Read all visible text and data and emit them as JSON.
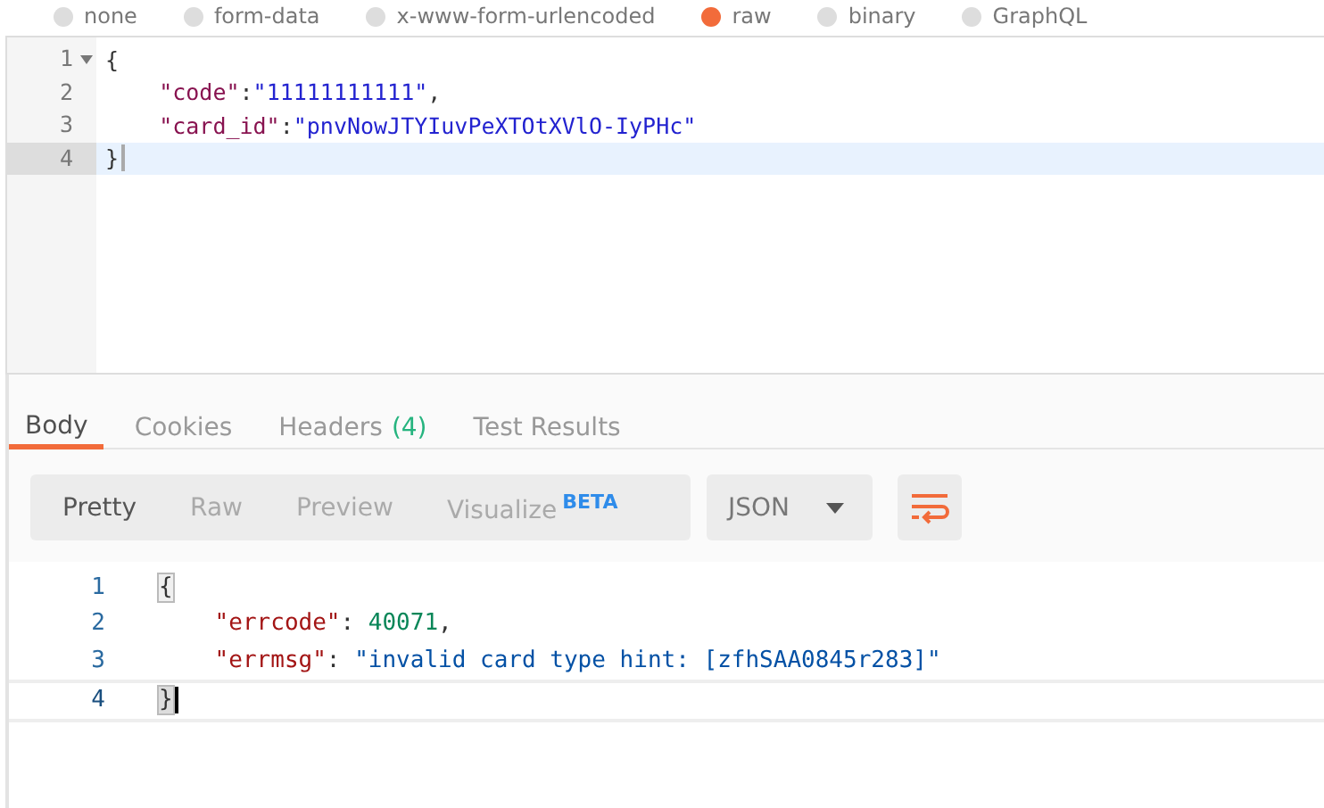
{
  "body_types": [
    {
      "label": "none",
      "selected": false
    },
    {
      "label": "form-data",
      "selected": false
    },
    {
      "label": "x-www-form-urlencoded",
      "selected": false
    },
    {
      "label": "raw",
      "selected": true
    },
    {
      "label": "binary",
      "selected": false
    },
    {
      "label": "GraphQL",
      "selected": false
    }
  ],
  "request_editor": {
    "lines": [
      {
        "number": "1",
        "foldable": true,
        "active": false,
        "tokens": [
          {
            "kind": "punct",
            "text": "{"
          }
        ]
      },
      {
        "number": "2",
        "foldable": false,
        "active": false,
        "tokens": [
          {
            "kind": "key",
            "text": "    \"code\""
          },
          {
            "kind": "punct",
            "text": ":"
          },
          {
            "kind": "string",
            "text": "\"11111111111\""
          },
          {
            "kind": "punct",
            "text": ","
          }
        ]
      },
      {
        "number": "3",
        "foldable": false,
        "active": false,
        "tokens": [
          {
            "kind": "key",
            "text": "    \"card_id\""
          },
          {
            "kind": "punct",
            "text": ":"
          },
          {
            "kind": "string",
            "text": "\"pnvNowJTYIuvPeXTOtXVlO-IyPHc\""
          }
        ]
      },
      {
        "number": "4",
        "foldable": false,
        "active": true,
        "tokens": [
          {
            "kind": "punct",
            "text": "}"
          }
        ]
      }
    ]
  },
  "response_tabs": [
    {
      "label": "Body",
      "selected": true
    },
    {
      "label": "Cookies",
      "selected": false
    },
    {
      "label": "Headers",
      "count": "(4)",
      "selected": false
    },
    {
      "label": "Test Results",
      "selected": false
    }
  ],
  "view_modes": [
    {
      "label": "Pretty",
      "selected": true
    },
    {
      "label": "Raw",
      "selected": false
    },
    {
      "label": "Preview",
      "selected": false
    },
    {
      "label": "Visualize",
      "badge": "BETA",
      "selected": false
    }
  ],
  "format_dropdown": {
    "value": "JSON"
  },
  "response_body": {
    "lines": [
      {
        "number": "1",
        "active": false,
        "tokens": [
          {
            "kind": "brace",
            "text": "{"
          }
        ]
      },
      {
        "number": "2",
        "active": false,
        "tokens": [
          {
            "kind": "key",
            "text": "    \"errcode\""
          },
          {
            "kind": "punct",
            "text": ": "
          },
          {
            "kind": "number",
            "text": "40071"
          },
          {
            "kind": "punct",
            "text": ","
          }
        ]
      },
      {
        "number": "3",
        "active": false,
        "tokens": [
          {
            "kind": "key",
            "text": "    \"errmsg\""
          },
          {
            "kind": "punct",
            "text": ": "
          },
          {
            "kind": "string",
            "text": "\"invalid card type hint: [zfhSAA0845r283]\""
          }
        ]
      },
      {
        "number": "4",
        "active": true,
        "tokens": [
          {
            "kind": "brace",
            "text": "}"
          }
        ]
      }
    ]
  }
}
